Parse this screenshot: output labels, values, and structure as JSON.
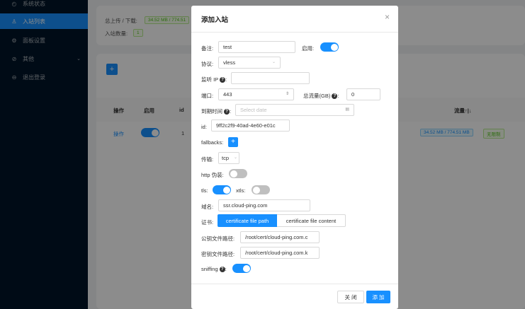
{
  "sidebar": {
    "items": [
      {
        "label": "系统状态",
        "icon": "dashboard-icon"
      },
      {
        "label": "入站列表",
        "icon": "user-icon",
        "active": true
      },
      {
        "label": "面板设置",
        "icon": "gear-icon"
      },
      {
        "label": "其他",
        "icon": "link-icon",
        "caret": true
      },
      {
        "label": "退出登录",
        "icon": "logout-icon"
      }
    ]
  },
  "stats": {
    "traffic_label": "总上传 / 下载:",
    "traffic_value": "34.52 MB / 774.51",
    "count_label": "入站数量:",
    "count_value": "1"
  },
  "table": {
    "add_label": "+",
    "headers": {
      "op": "操作",
      "enable": "启用",
      "id": "id",
      "traffic": "流量↑|↓"
    },
    "row": {
      "op": "操作",
      "id": "1",
      "traffic": "34.52 MB / 774.51 MB",
      "limit": "无限制"
    }
  },
  "modal": {
    "title": "添加入站",
    "close": "×",
    "remark_label": "备注:",
    "remark_value": "test",
    "enable_label": "启用:",
    "protocol_label": "协议:",
    "protocol_value": "vless",
    "listen_label": "监听 IP",
    "listen_value": "",
    "port_label": "端口:",
    "port_value": "443",
    "total_label": "总流量(GB)",
    "total_value": "0",
    "expiry_label": "到期时间",
    "expiry_placeholder": "Select date",
    "id_label": "id:",
    "id_value": "9ff2c2f9-40ad-4e60-e01c",
    "fallbacks_label": "fallbacks:",
    "fallbacks_add": "+",
    "transport_label": "传输:",
    "transport_value": "tcp",
    "http_label": "http 伪装:",
    "tls_label": "tls:",
    "xtls_label": "xtls:",
    "domain_label": "域名:",
    "domain_value": "ssr.cloud-ping.com",
    "cert_label": "证书:",
    "cert_path_tab": "certificate file path",
    "cert_content_tab": "certificate file content",
    "pub_label": "公钥文件路径:",
    "pub_value": "/root/cert/cloud-ping.com.c",
    "key_label": "密钥文件路径:",
    "key_value": "/root/cert/cloud-ping.com.k",
    "sniffing_label": "sniffing",
    "cancel_label": "关 闭",
    "ok_label": "添 加",
    "help_icon": "question-icon"
  }
}
